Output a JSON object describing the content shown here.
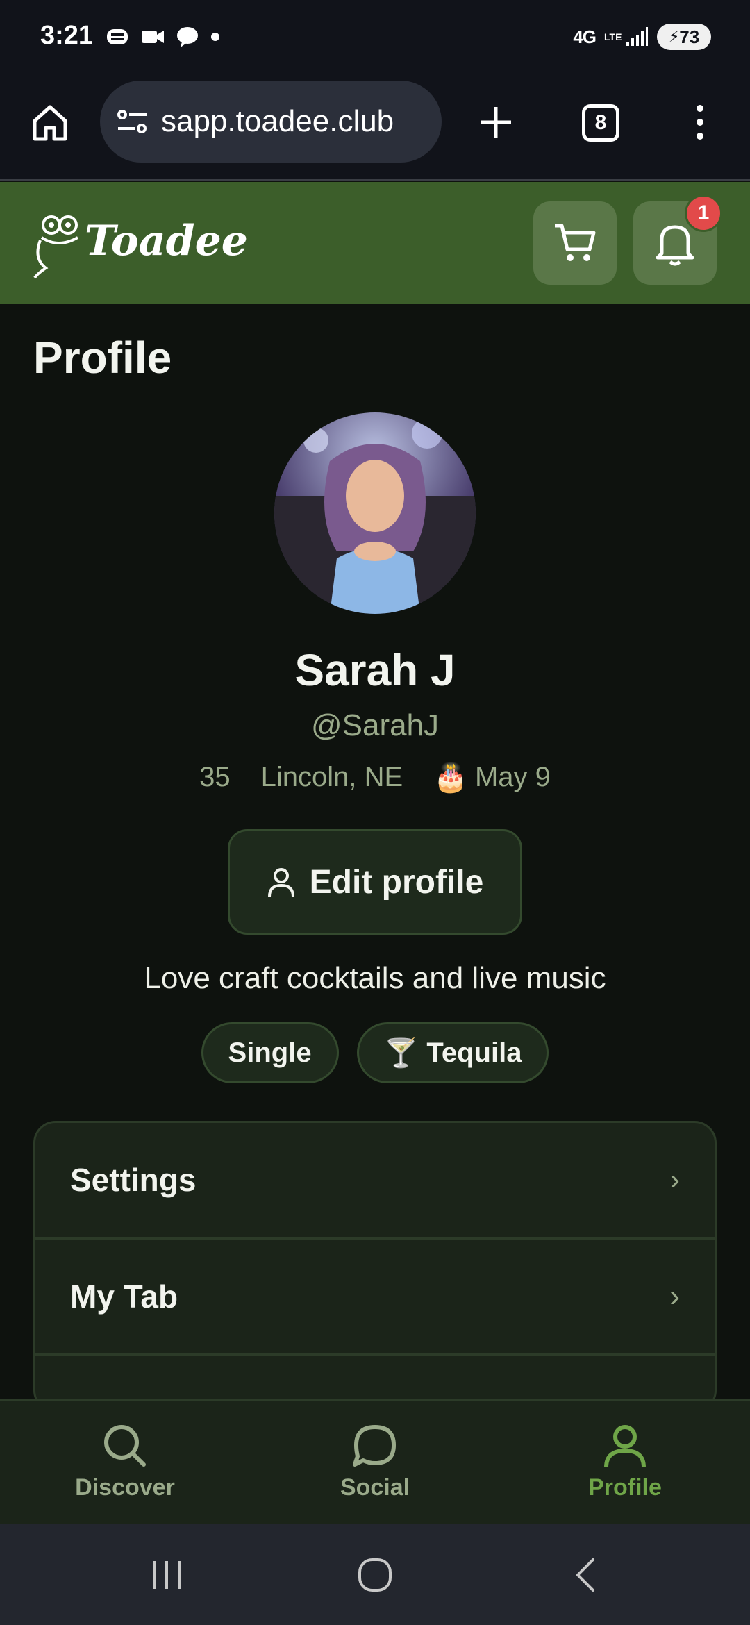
{
  "status_bar": {
    "time": "3:21",
    "network": "4G",
    "network_sub": "LTE",
    "battery": "73"
  },
  "browser": {
    "url": "sapp.toadee.club",
    "tab_count": "8"
  },
  "header": {
    "logo_text": "Toadee",
    "notification_count": "1"
  },
  "page": {
    "title": "Profile"
  },
  "profile": {
    "name": "Sarah J",
    "handle": "@SarahJ",
    "age": "35",
    "location": "Lincoln, NE",
    "birthday_emoji": "🎂",
    "birthday": "May 9",
    "edit_label": "Edit profile",
    "bio": "Love craft cocktails and live music",
    "chips": [
      {
        "icon": "",
        "label": "Single"
      },
      {
        "icon": "🍸",
        "label": "Tequila"
      }
    ]
  },
  "menu": [
    {
      "label": "Settings",
      "chevron": "›"
    },
    {
      "label": "My Tab",
      "chevron": "›"
    },
    {
      "label": "",
      "chevron": ""
    }
  ],
  "bottom_nav": [
    {
      "label": "Discover",
      "icon": "search-icon"
    },
    {
      "label": "Social",
      "icon": "chat-icon"
    },
    {
      "label": "Profile",
      "icon": "person-icon",
      "active": true
    }
  ],
  "colors": {
    "header_green": "#3c5e2a",
    "accent_green": "#6fa548",
    "badge_red": "#e24a4a"
  }
}
